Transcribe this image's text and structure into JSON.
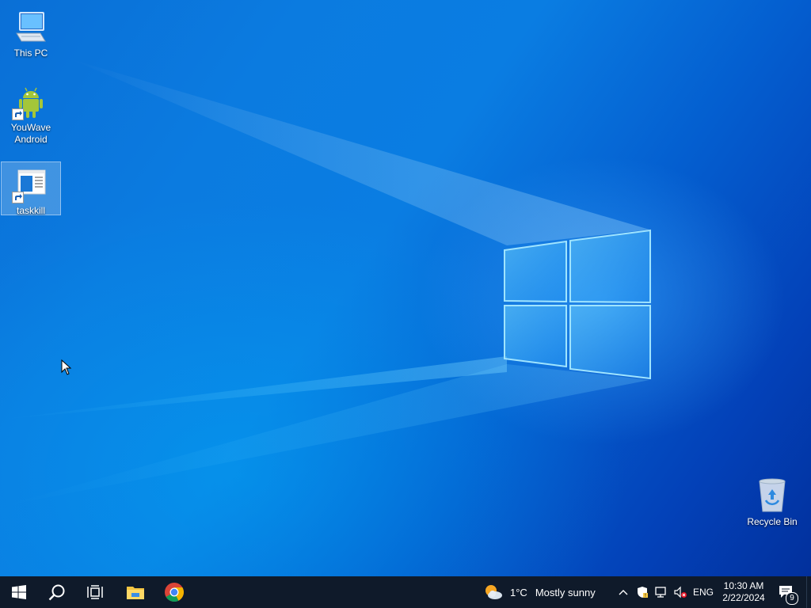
{
  "desktop": {
    "icons": [
      {
        "label": "This PC",
        "icon": "this-pc-icon"
      },
      {
        "label": "YouWave\nAndroid",
        "icon": "android-icon"
      },
      {
        "label": "taskkill",
        "icon": "window-icon"
      },
      {
        "label": "Recycle Bin",
        "icon": "recycle-bin-icon"
      }
    ]
  },
  "taskbar": {
    "start_icon": "windows-start-icon",
    "search_icon": "search-icon",
    "task_view_icon": "task-view-icon",
    "pinned": [
      {
        "name": "File Explorer",
        "icon": "file-explorer-icon"
      },
      {
        "name": "Google Chrome",
        "icon": "chrome-icon"
      }
    ],
    "weather": {
      "temperature": "1°C",
      "condition": "Mostly sunny",
      "icon": "partly-sunny-icon"
    },
    "tray": {
      "icons": [
        "chevron-up-icon",
        "security-icon",
        "network-icon",
        "volume-muted-icon"
      ],
      "language": "ENG",
      "time": "10:30 AM",
      "date": "2/22/2024",
      "notifications_count": "9"
    }
  },
  "colors": {
    "taskbar": "#0f1a2a",
    "desktop_blue": "#0a7de2",
    "accent": "#4fc3ff"
  }
}
